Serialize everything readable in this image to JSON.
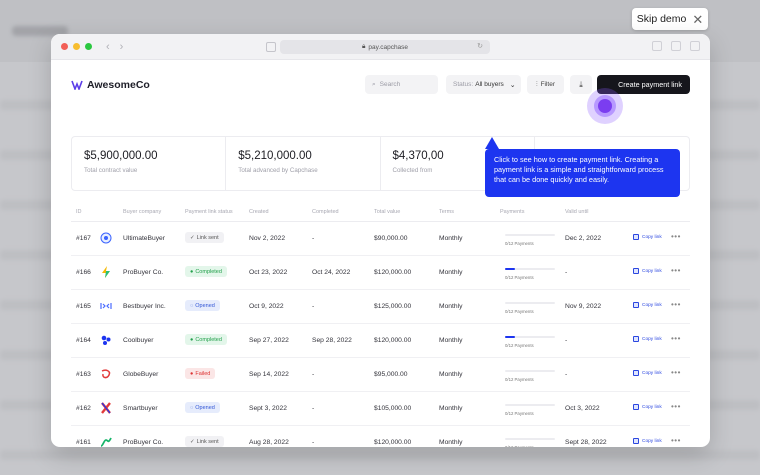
{
  "skip_demo": {
    "label": "Skip demo",
    "close": "✕"
  },
  "browser": {
    "url": "pay.capchase"
  },
  "app": {
    "brand": "AwesomeCo",
    "search_placeholder": "Search",
    "status_filter_prefix": "Status:",
    "status_filter_value": "All buyers",
    "filter_label": "Filter",
    "create_label": "Create payment link"
  },
  "stats": [
    {
      "amount": "$5,900,000.00",
      "label": "Total contract value"
    },
    {
      "amount": "$5,210,000.00",
      "label": "Total advanced by Capchase"
    },
    {
      "amount": "$4,370,00",
      "label": "Collected from"
    }
  ],
  "tooltip": "Click to see how to create payment link. Creating a payment link is a simple and straightforward process that can be done quickly and easily.",
  "table": {
    "headers": {
      "id": "ID",
      "buyer": "Buyer company",
      "status": "Payment link status",
      "created": "Created",
      "completed": "Completed",
      "total": "Total value",
      "terms": "Terms",
      "payments": "Payments",
      "valid": "Valid until"
    },
    "copy_label": "Copy link",
    "more": "•••",
    "rows": [
      {
        "id": "#167",
        "buyer": "UltimateBuyer",
        "status": "Link sent",
        "status_kind": "sent",
        "created": "Nov 2, 2022",
        "completed": "-",
        "total": "$90,000.00",
        "terms": "Monthly",
        "payments": "0/12 Payments",
        "progress": 0,
        "valid": "Dec 2, 2022",
        "logo": "ultimate-icon"
      },
      {
        "id": "#166",
        "buyer": "ProBuyer Co.",
        "status": "Completed",
        "status_kind": "completed",
        "created": "Oct 23, 2022",
        "completed": "Oct 24, 2022",
        "total": "$120,000.00",
        "terms": "Monthly",
        "payments": "0/12 Payments",
        "progress": 0.2,
        "valid": "-",
        "logo": "bolt-icon"
      },
      {
        "id": "#165",
        "buyer": "Bestbuyer Inc.",
        "status": "Opened",
        "status_kind": "opened",
        "created": "Oct 9, 2022",
        "completed": "-",
        "total": "$125,000.00",
        "terms": "Monthly",
        "payments": "0/12 Payments",
        "progress": 0,
        "valid": "Nov 9, 2022",
        "logo": "bestbuyer-icon"
      },
      {
        "id": "#164",
        "buyer": "Coolbuyer",
        "status": "Completed",
        "status_kind": "completed",
        "created": "Sep 27, 2022",
        "completed": "Sep 28, 2022",
        "total": "$120,000.00",
        "terms": "Monthly",
        "payments": "0/12 Payments",
        "progress": 0.2,
        "valid": "-",
        "logo": "coolbuyer-icon"
      },
      {
        "id": "#163",
        "buyer": "GlobeBuyer",
        "status": "Failed",
        "status_kind": "failed",
        "created": "Sep 14, 2022",
        "completed": "-",
        "total": "$95,000.00",
        "terms": "Monthly",
        "payments": "0/12 Payments",
        "progress": 0,
        "valid": "-",
        "logo": "globe-icon"
      },
      {
        "id": "#162",
        "buyer": "Smartbuyer",
        "status": "Opened",
        "status_kind": "opened",
        "created": "Sept 3, 2022",
        "completed": "-",
        "total": "$105,000.00",
        "terms": "Monthly",
        "payments": "0/12 Payments",
        "progress": 0,
        "valid": "Oct 3, 2022",
        "logo": "smart-icon"
      },
      {
        "id": "#161",
        "buyer": "ProBuyer Co.",
        "status": "Link sent",
        "status_kind": "sent",
        "created": "Aug 28, 2022",
        "completed": "-",
        "total": "$120,000.00",
        "terms": "Monthly",
        "payments": "0/12 Payments",
        "progress": 0,
        "valid": "Sept 28, 2022",
        "logo": "wave-icon"
      }
    ]
  },
  "colors": {
    "accent": "#1d35f0",
    "pulse": "#7b3df0",
    "dark_button": "#16161c"
  }
}
